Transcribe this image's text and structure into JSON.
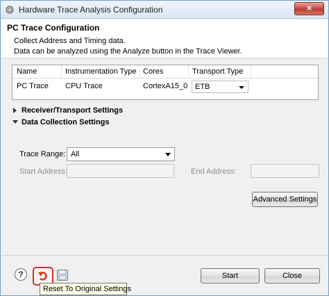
{
  "window": {
    "title": "Hardware Trace Analysis Configuration",
    "close_glyph": "×"
  },
  "header": {
    "title": "PC Trace Configuration",
    "description_line1": "Collect Address and Timing data.",
    "description_line2": "Data can be analyzed using the Analyze button in the Trace Viewer."
  },
  "table": {
    "headers": [
      "Name",
      "Instrumentation Type",
      "Cores",
      "Transport Type"
    ],
    "row": {
      "name": "PC Trace",
      "instrumentation_type": "CPU Trace",
      "cores": "CortexA15_0",
      "transport_type": "ETB"
    }
  },
  "sections": {
    "receiver_transport": "Receiver/Transport Settings",
    "data_collection": "Data Collection Settings"
  },
  "data_collection": {
    "trace_range_label": "Trace Range:",
    "trace_range_value": "All",
    "start_address_label": "Start Address:",
    "start_address_value": "",
    "end_address_label": "End Address:",
    "end_address_value": ""
  },
  "buttons": {
    "advanced_settings": "Advanced Settings",
    "start": "Start",
    "close": "Close",
    "help_glyph": "?"
  },
  "tooltip": {
    "text": "Reset To Original Settings"
  },
  "icons": {
    "app": "gear-icon",
    "reset": "undo-icon",
    "save": "save-icon"
  },
  "colors": {
    "highlight_border": "#d62b2b",
    "reset_arrow": "#e03a1e"
  }
}
